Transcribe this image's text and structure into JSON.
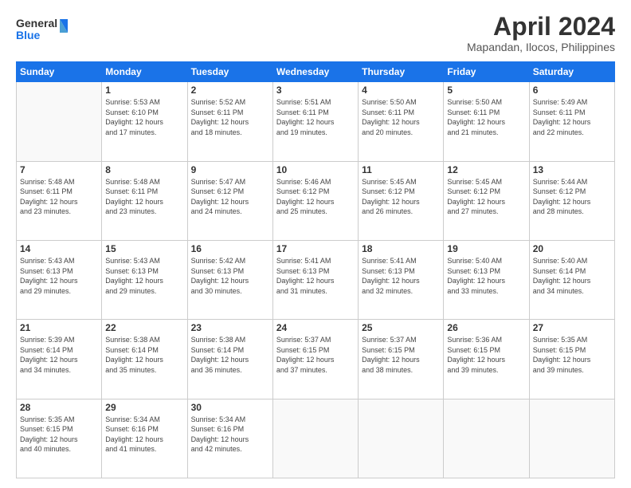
{
  "header": {
    "logo_line1": "General",
    "logo_line2": "Blue",
    "title": "April 2024",
    "subtitle": "Mapandan, Ilocos, Philippines"
  },
  "weekdays": [
    "Sunday",
    "Monday",
    "Tuesday",
    "Wednesday",
    "Thursday",
    "Friday",
    "Saturday"
  ],
  "weeks": [
    [
      {
        "day": "",
        "info": ""
      },
      {
        "day": "1",
        "info": "Sunrise: 5:53 AM\nSunset: 6:10 PM\nDaylight: 12 hours\nand 17 minutes."
      },
      {
        "day": "2",
        "info": "Sunrise: 5:52 AM\nSunset: 6:11 PM\nDaylight: 12 hours\nand 18 minutes."
      },
      {
        "day": "3",
        "info": "Sunrise: 5:51 AM\nSunset: 6:11 PM\nDaylight: 12 hours\nand 19 minutes."
      },
      {
        "day": "4",
        "info": "Sunrise: 5:50 AM\nSunset: 6:11 PM\nDaylight: 12 hours\nand 20 minutes."
      },
      {
        "day": "5",
        "info": "Sunrise: 5:50 AM\nSunset: 6:11 PM\nDaylight: 12 hours\nand 21 minutes."
      },
      {
        "day": "6",
        "info": "Sunrise: 5:49 AM\nSunset: 6:11 PM\nDaylight: 12 hours\nand 22 minutes."
      }
    ],
    [
      {
        "day": "7",
        "info": "Sunrise: 5:48 AM\nSunset: 6:11 PM\nDaylight: 12 hours\nand 23 minutes."
      },
      {
        "day": "8",
        "info": "Sunrise: 5:48 AM\nSunset: 6:11 PM\nDaylight: 12 hours\nand 23 minutes."
      },
      {
        "day": "9",
        "info": "Sunrise: 5:47 AM\nSunset: 6:12 PM\nDaylight: 12 hours\nand 24 minutes."
      },
      {
        "day": "10",
        "info": "Sunrise: 5:46 AM\nSunset: 6:12 PM\nDaylight: 12 hours\nand 25 minutes."
      },
      {
        "day": "11",
        "info": "Sunrise: 5:45 AM\nSunset: 6:12 PM\nDaylight: 12 hours\nand 26 minutes."
      },
      {
        "day": "12",
        "info": "Sunrise: 5:45 AM\nSunset: 6:12 PM\nDaylight: 12 hours\nand 27 minutes."
      },
      {
        "day": "13",
        "info": "Sunrise: 5:44 AM\nSunset: 6:12 PM\nDaylight: 12 hours\nand 28 minutes."
      }
    ],
    [
      {
        "day": "14",
        "info": "Sunrise: 5:43 AM\nSunset: 6:13 PM\nDaylight: 12 hours\nand 29 minutes."
      },
      {
        "day": "15",
        "info": "Sunrise: 5:43 AM\nSunset: 6:13 PM\nDaylight: 12 hours\nand 29 minutes."
      },
      {
        "day": "16",
        "info": "Sunrise: 5:42 AM\nSunset: 6:13 PM\nDaylight: 12 hours\nand 30 minutes."
      },
      {
        "day": "17",
        "info": "Sunrise: 5:41 AM\nSunset: 6:13 PM\nDaylight: 12 hours\nand 31 minutes."
      },
      {
        "day": "18",
        "info": "Sunrise: 5:41 AM\nSunset: 6:13 PM\nDaylight: 12 hours\nand 32 minutes."
      },
      {
        "day": "19",
        "info": "Sunrise: 5:40 AM\nSunset: 6:13 PM\nDaylight: 12 hours\nand 33 minutes."
      },
      {
        "day": "20",
        "info": "Sunrise: 5:40 AM\nSunset: 6:14 PM\nDaylight: 12 hours\nand 34 minutes."
      }
    ],
    [
      {
        "day": "21",
        "info": "Sunrise: 5:39 AM\nSunset: 6:14 PM\nDaylight: 12 hours\nand 34 minutes."
      },
      {
        "day": "22",
        "info": "Sunrise: 5:38 AM\nSunset: 6:14 PM\nDaylight: 12 hours\nand 35 minutes."
      },
      {
        "day": "23",
        "info": "Sunrise: 5:38 AM\nSunset: 6:14 PM\nDaylight: 12 hours\nand 36 minutes."
      },
      {
        "day": "24",
        "info": "Sunrise: 5:37 AM\nSunset: 6:15 PM\nDaylight: 12 hours\nand 37 minutes."
      },
      {
        "day": "25",
        "info": "Sunrise: 5:37 AM\nSunset: 6:15 PM\nDaylight: 12 hours\nand 38 minutes."
      },
      {
        "day": "26",
        "info": "Sunrise: 5:36 AM\nSunset: 6:15 PM\nDaylight: 12 hours\nand 39 minutes."
      },
      {
        "day": "27",
        "info": "Sunrise: 5:35 AM\nSunset: 6:15 PM\nDaylight: 12 hours\nand 39 minutes."
      }
    ],
    [
      {
        "day": "28",
        "info": "Sunrise: 5:35 AM\nSunset: 6:15 PM\nDaylight: 12 hours\nand 40 minutes."
      },
      {
        "day": "29",
        "info": "Sunrise: 5:34 AM\nSunset: 6:16 PM\nDaylight: 12 hours\nand 41 minutes."
      },
      {
        "day": "30",
        "info": "Sunrise: 5:34 AM\nSunset: 6:16 PM\nDaylight: 12 hours\nand 42 minutes."
      },
      {
        "day": "",
        "info": ""
      },
      {
        "day": "",
        "info": ""
      },
      {
        "day": "",
        "info": ""
      },
      {
        "day": "",
        "info": ""
      }
    ]
  ]
}
